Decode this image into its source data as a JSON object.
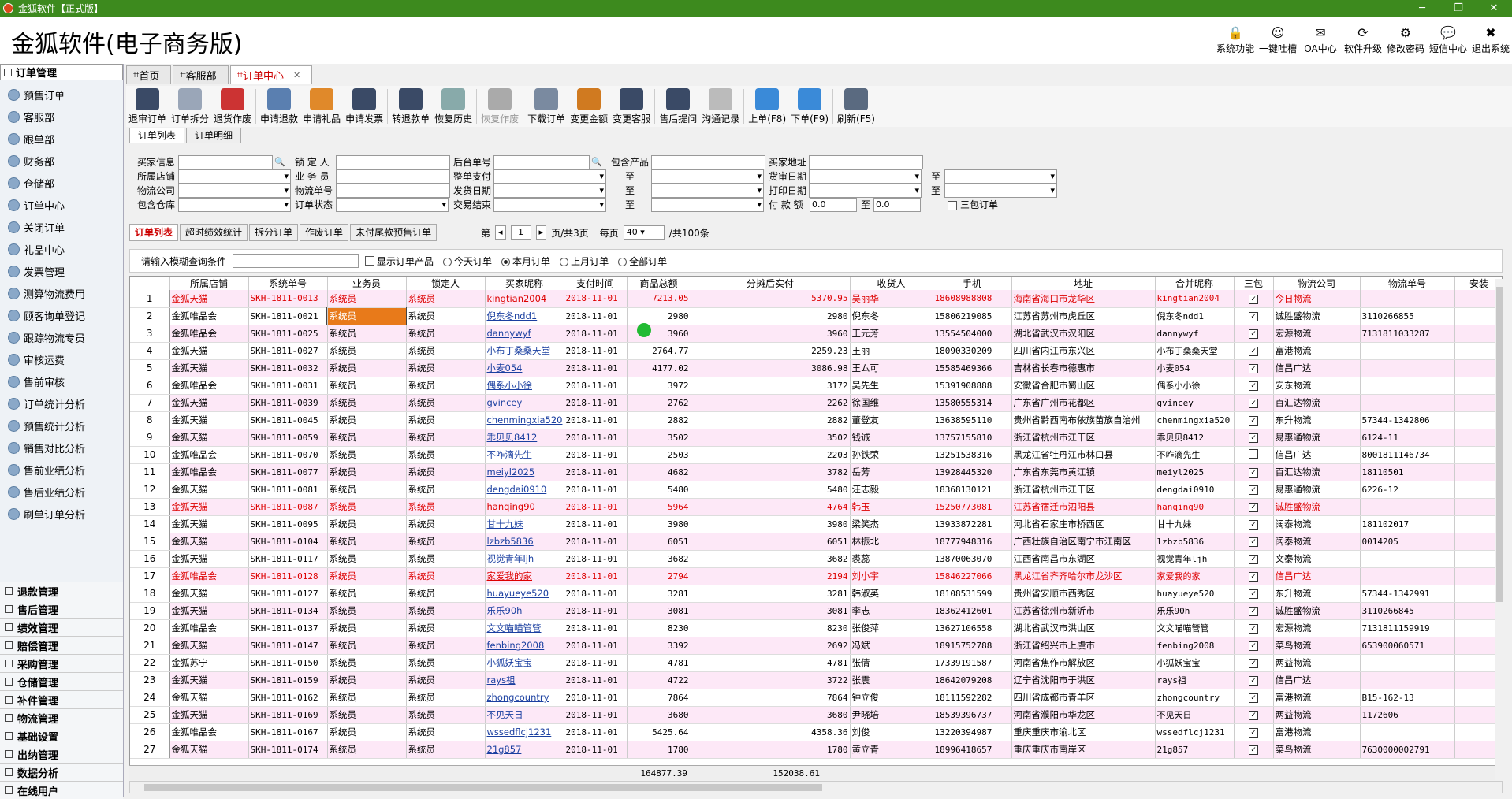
{
  "window": {
    "title": "金狐软件【正式版】"
  },
  "app": {
    "title": "金狐软件(电子商务版)"
  },
  "header_icons": [
    {
      "icon": "lock-icon",
      "label": "系统功能",
      "glyph": "🔒"
    },
    {
      "icon": "smiley-icon",
      "label": "一键吐槽",
      "glyph": "☺"
    },
    {
      "icon": "mail-icon",
      "label": "OA中心",
      "glyph": "✉"
    },
    {
      "icon": "upgrade-icon",
      "label": "软件升级",
      "glyph": "⟳"
    },
    {
      "icon": "settings-icon",
      "label": "修改密码",
      "glyph": "⚙"
    },
    {
      "icon": "sms-icon",
      "label": "短信中心",
      "glyph": "💬"
    },
    {
      "icon": "exit-icon",
      "label": "退出系统",
      "glyph": "✖"
    }
  ],
  "left": {
    "header": "订单管理",
    "items": [
      "预售订单",
      "客服部",
      "跟单部",
      "财务部",
      "仓储部",
      "订单中心",
      "关闭订单",
      "礼品中心",
      "发票管理",
      "测算物流费用",
      "顾客询单登记",
      "跟踪物流专员",
      "审核运费",
      "售前审核",
      "订单统计分析",
      "预售统计分析",
      "销售对比分析",
      "售前业绩分析",
      "售后业绩分析",
      "刷单订单分析"
    ],
    "groups": [
      "退款管理",
      "售后管理",
      "绩效管理",
      "赔偿管理",
      "采购管理",
      "仓储管理",
      "补件管理",
      "物流管理",
      "基础设置",
      "出纳管理",
      "数据分析",
      "在线用户"
    ]
  },
  "tabs": [
    "首页",
    "客服部",
    "订单中心"
  ],
  "toolbar": [
    {
      "label": "退审订单",
      "color": "#3a4a66"
    },
    {
      "label": "订单拆分",
      "color": "#9aa6b8"
    },
    {
      "label": "退货作废",
      "color": "#c33"
    },
    {
      "label": "申请退款",
      "color": "#5a7fb0"
    },
    {
      "label": "申请礼品",
      "color": "#e0892a"
    },
    {
      "label": "申请发票",
      "color": "#3a4a66"
    },
    {
      "label": "转退款单",
      "color": "#3a4a66"
    },
    {
      "label": "恢复历史",
      "color": "#8aa"
    },
    {
      "label": "恢复作废",
      "color": "#aaa",
      "disabled": true
    },
    {
      "label": "下载订单",
      "color": "#7a8aa0"
    },
    {
      "label": "变更金额",
      "color": "#d07a20"
    },
    {
      "label": "变更客服",
      "color": "#3a4a66"
    },
    {
      "label": "售后提问",
      "color": "#3a4a66"
    },
    {
      "label": "沟通记录",
      "color": "#bbb"
    },
    {
      "label": "上单(F8)",
      "color": "#3a8ad8"
    },
    {
      "label": "下单(F9)",
      "color": "#3a8ad8"
    },
    {
      "label": "刷新(F5)",
      "color": "#5a6a80"
    }
  ],
  "subtabs": [
    "订单列表",
    "订单明细"
  ],
  "filter": {
    "labels": [
      "买家信息",
      "锁 定 人",
      "后台单号",
      "包含产品",
      "买家地址",
      "所属店铺",
      "业 务 员",
      "整单支付",
      "至",
      "货审日期",
      "至",
      "物流公司",
      "物流单号",
      "发货日期",
      "至",
      "打印日期",
      "至",
      "包含仓库",
      "订单状态",
      "交易结束",
      "至",
      "付 款 额",
      "至",
      "三包订单"
    ],
    "amount_from": "0.0",
    "amount_to": "0.0"
  },
  "list_tabs": [
    "订单列表",
    "超时绩效统计",
    "拆分订单",
    "作废订单",
    "未付尾款预售订单"
  ],
  "pager": {
    "prefix": "第",
    "page": "1",
    "total_pages": "页/共3页",
    "per_page_label": "每页",
    "per_page": "40",
    "total": "/共100条"
  },
  "search": {
    "label": "请输入模糊查询条件",
    "show_products": "显示订单产品",
    "radios": [
      "今天订单",
      "本月订单",
      "上月订单",
      "全部订单"
    ]
  },
  "columns": [
    "所属店铺",
    "系统单号",
    "业务员",
    "锁定人",
    "买家昵称",
    "支付时间",
    "商品总额",
    "分摊后实付",
    "收货人",
    "手机",
    "地址",
    "合并昵称",
    "三包",
    "物流公司",
    "物流单号",
    "安装"
  ],
  "rows": [
    [
      "金狐天猫",
      "SKH-1811-0013",
      "系统员",
      "系统员",
      "kingtian2004",
      "2018-11-01",
      "7213.05",
      "5370.95",
      "吴丽华",
      "18608988808",
      "海南省海口市龙华区",
      "kingtian2004",
      true,
      "今日物流",
      ""
    ],
    [
      "金狐唯品会",
      "SKH-1811-0021",
      "系统员",
      "系统员",
      "倪东冬ndd1",
      "2018-11-01",
      "2980",
      "2980",
      "倪东冬",
      "15806219085",
      "江苏省苏州市虎丘区",
      "倪东冬ndd1",
      true,
      "诚胜盛物流",
      "3110266855"
    ],
    [
      "金狐唯品会",
      "SKH-1811-0025",
      "系统员",
      "系统员",
      "dannywyf",
      "2018-11-01",
      "3960",
      "3960",
      "王元芳",
      "13554504000",
      "湖北省武汉市汉阳区",
      "dannywyf",
      true,
      "宏源物流",
      "7131811033287"
    ],
    [
      "金狐天猫",
      "SKH-1811-0027",
      "系统员",
      "系统员",
      "小布丁桑桑天堂",
      "2018-11-01",
      "2764.77",
      "2259.23",
      "王丽",
      "18090330209",
      "四川省内江市东兴区",
      "小布丁桑桑天堂",
      true,
      "富港物流",
      ""
    ],
    [
      "金狐天猫",
      "SKH-1811-0032",
      "系统员",
      "系统员",
      "小麦054",
      "2018-11-01",
      "4177.02",
      "3086.98",
      "王ム可",
      "15585469366",
      "吉林省长春市德惠市",
      "小麦054",
      true,
      "信昌广达",
      ""
    ],
    [
      "金狐唯品会",
      "SKH-1811-0031",
      "系统员",
      "系统员",
      "偶系小小徐",
      "2018-11-01",
      "3972",
      "3172",
      "吴先生",
      "15391908888",
      "安徽省合肥市蜀山区",
      "偶系小小徐",
      true,
      "安东物流",
      ""
    ],
    [
      "金狐天猫",
      "SKH-1811-0039",
      "系统员",
      "系统员",
      "gvincey",
      "2018-11-01",
      "2762",
      "2262",
      "徐国维",
      "13580555314",
      "广东省广州市花都区",
      "gvincey",
      true,
      "百汇达物流",
      ""
    ],
    [
      "金狐天猫",
      "SKH-1811-0045",
      "系统员",
      "系统员",
      "chenmingxia520",
      "2018-11-01",
      "2882",
      "2882",
      "董登友",
      "13638595110",
      "贵州省黔西南布依族苗族自治州",
      "chenmingxia520",
      true,
      "东升物流",
      "57344-1342806"
    ],
    [
      "金狐天猫",
      "SKH-1811-0059",
      "系统员",
      "系统员",
      "乖贝贝8412",
      "2018-11-01",
      "3502",
      "3502",
      "钱诚",
      "13757155810",
      "浙江省杭州市江干区",
      "乖贝贝8412",
      true,
      "易惠通物流",
      "6124-11"
    ],
    [
      "金狐唯品会",
      "SKH-1811-0070",
      "系统员",
      "系统员",
      "不咋滴先生",
      "2018-11-01",
      "2503",
      "2203",
      "孙铁荣",
      "13251538316",
      "黑龙江省牡丹江市林口县",
      "不咋滴先生",
      false,
      "信昌广达",
      "8001811146734"
    ],
    [
      "金狐唯品会",
      "SKH-1811-0077",
      "系统员",
      "系统员",
      "meiyl2025",
      "2018-11-01",
      "4682",
      "3782",
      "岳芳",
      "13928445320",
      "广东省东莞市黄江镇",
      "meiyl2025",
      true,
      "百汇达物流",
      "18110501"
    ],
    [
      "金狐天猫",
      "SKH-1811-0081",
      "系统员",
      "系统员",
      "dengdai0910",
      "2018-11-01",
      "5480",
      "5480",
      "汪志毅",
      "18368130121",
      "浙江省杭州市江干区",
      "dengdai0910",
      true,
      "易惠通物流",
      "6226-12"
    ],
    [
      "金狐天猫",
      "SKH-1811-0087",
      "系统员",
      "系统员",
      "hanqing90",
      "2018-11-01",
      "5964",
      "4764",
      "韩玉",
      "15250773081",
      "江苏省宿迁市泗阳县",
      "hanqing90",
      true,
      "诚胜盛物流",
      ""
    ],
    [
      "金狐天猫",
      "SKH-1811-0095",
      "系统员",
      "系统员",
      "甘十九妹",
      "2018-11-01",
      "3980",
      "3980",
      "梁笑杰",
      "13933872281",
      "河北省石家庄市桥西区",
      "甘十九妹",
      true,
      "阔泰物流",
      "181102017"
    ],
    [
      "金狐天猫",
      "SKH-1811-0104",
      "系统员",
      "系统员",
      "lzbzb5836",
      "2018-11-01",
      "6051",
      "6051",
      "林振北",
      "18777948316",
      "广西壮族自治区南宁市江南区",
      "lzbzb5836",
      true,
      "阔泰物流",
      "0014205"
    ],
    [
      "金狐天猫",
      "SKH-1811-0117",
      "系统员",
      "系统员",
      "视觉青年ljh",
      "2018-11-01",
      "3682",
      "3682",
      "裘蕊",
      "13870063070",
      "江西省南昌市东湖区",
      "视觉青年ljh",
      true,
      "文泰物流",
      ""
    ],
    [
      "金狐唯品会",
      "SKH-1811-0128",
      "系统员",
      "系统员",
      "家爱我的家",
      "2018-11-01",
      "2794",
      "2194",
      "刘小宇",
      "15846227066",
      "黑龙江省齐齐哈尔市龙沙区",
      "家爱我的家",
      true,
      "信昌广达",
      ""
    ],
    [
      "金狐天猫",
      "SKH-1811-0127",
      "系统员",
      "系统员",
      "huayueye520",
      "2018-11-01",
      "3281",
      "3281",
      "韩淑英",
      "18108531599",
      "贵州省安顺市西秀区",
      "huayueye520",
      true,
      "东升物流",
      "57344-1342991"
    ],
    [
      "金狐天猫",
      "SKH-1811-0134",
      "系统员",
      "系统员",
      "乐乐90h",
      "2018-11-01",
      "3081",
      "3081",
      "李志",
      "18362412601",
      "江苏省徐州市新沂市",
      "乐乐90h",
      true,
      "诚胜盛物流",
      "3110266845"
    ],
    [
      "金狐唯品会",
      "SKH-1811-0137",
      "系统员",
      "系统员",
      "文文喵喵管管",
      "2018-11-01",
      "8230",
      "8230",
      "张俊萍",
      "13627106558",
      "湖北省武汉市洪山区",
      "文文喵喵管管",
      true,
      "宏源物流",
      "7131811159919"
    ],
    [
      "金狐天猫",
      "SKH-1811-0147",
      "系统员",
      "系统员",
      "fenbing2008",
      "2018-11-01",
      "3392",
      "2692",
      "冯斌",
      "18915752788",
      "浙江省绍兴市上虞市",
      "fenbing2008",
      true,
      "菜鸟物流",
      "653900060571"
    ],
    [
      "金狐苏宁",
      "SKH-1811-0150",
      "系统员",
      "系统员",
      "小狐妖宝宝",
      "2018-11-01",
      "4781",
      "4781",
      "张倩",
      "17339191587",
      "河南省焦作市解放区",
      "小狐妖宝宝",
      true,
      "两益物流",
      ""
    ],
    [
      "金狐天猫",
      "SKH-1811-0159",
      "系统员",
      "系统员",
      "rays祖",
      "2018-11-01",
      "4722",
      "3722",
      "张震",
      "18642079208",
      "辽宁省沈阳市于洪区",
      "rays祖",
      true,
      "信昌广达",
      ""
    ],
    [
      "金狐天猫",
      "SKH-1811-0162",
      "系统员",
      "系统员",
      "zhongcountry",
      "2018-11-01",
      "7864",
      "7864",
      "钟立俊",
      "18111592282",
      "四川省成都市青羊区",
      "zhongcountry",
      true,
      "富港物流",
      "B15-162-13"
    ],
    [
      "金狐天猫",
      "SKH-1811-0169",
      "系统员",
      "系统员",
      "不见天日",
      "2018-11-01",
      "3680",
      "3680",
      "尹晓培",
      "18539396737",
      "河南省濮阳市华龙区",
      "不见天日",
      true,
      "两益物流",
      "1172606"
    ],
    [
      "金狐唯品会",
      "SKH-1811-0167",
      "系统员",
      "系统员",
      "wssedflcj1231",
      "2018-11-01",
      "5425.64",
      "4358.36",
      "刘俊",
      "13220394987",
      "重庆重庆市渝北区",
      "wssedflcj1231",
      true,
      "富港物流",
      ""
    ],
    [
      "金狐天猫",
      "SKH-1811-0174",
      "系统员",
      "系统员",
      "21g857",
      "2018-11-01",
      "1780",
      "1780",
      "黄立青",
      "18996418657",
      "重庆重庆市南岸区",
      "21g857",
      true,
      "菜鸟物流",
      "7630000002791"
    ]
  ],
  "totals": {
    "goods_total": "164877.39",
    "paid_total": "152038.61"
  }
}
